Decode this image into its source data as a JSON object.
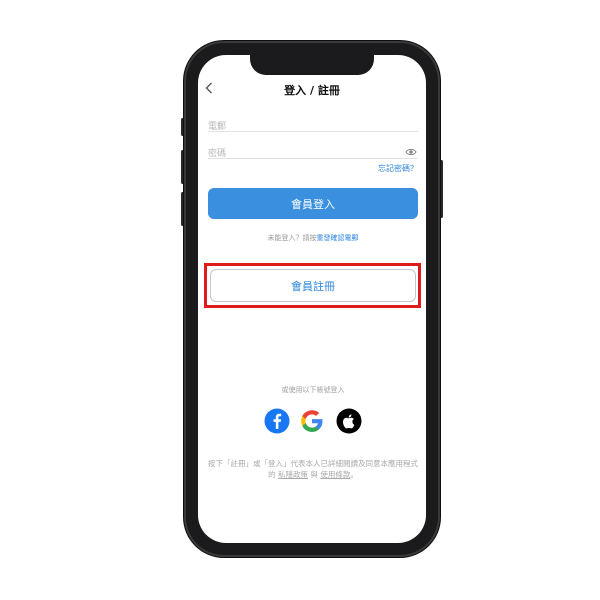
{
  "header": {
    "title": "登入 / 註冊",
    "back_icon": "chevron-left-icon"
  },
  "form": {
    "email_placeholder": "電郵",
    "password_placeholder": "密碼",
    "password_toggle_icon": "eye-icon",
    "forgot_password": "忘記密碼？",
    "login_button": "會員登入",
    "resend_prefix": "未能登入？請按",
    "resend_link": "重發確認電郵",
    "register_button": "會員註冊"
  },
  "social": {
    "caption": "或使用以下帳號登入",
    "providers": [
      "facebook-icon",
      "google-icon",
      "apple-icon"
    ]
  },
  "terms": {
    "text_1": "按下「註冊」或「登入」代表本人已詳細閱讀及同意本應用程式的",
    "privacy_link": "私隱政策",
    "and": "與",
    "terms_link": "使用條款",
    "end": "。"
  },
  "colors": {
    "primary": "#3a8fdf",
    "link": "#2e86de",
    "highlight": "#e01b1b",
    "facebook": "#1877f2"
  }
}
